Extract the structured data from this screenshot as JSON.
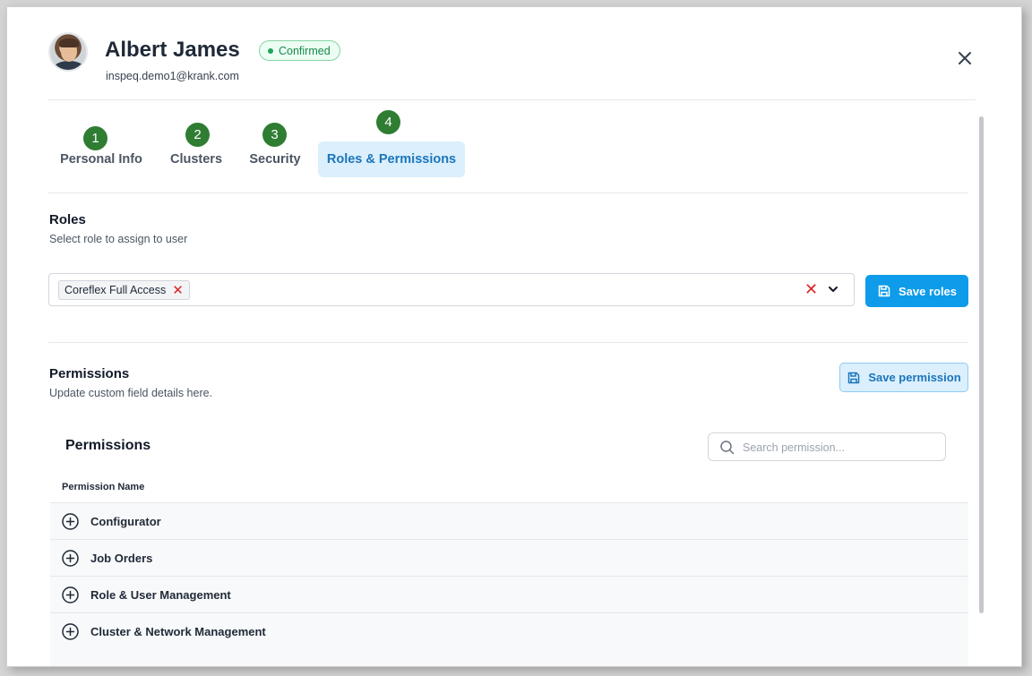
{
  "user": {
    "name": "Albert James",
    "status": "Confirmed",
    "email": "inspeq.demo1@krank.com"
  },
  "tabs": [
    {
      "step": "1",
      "label": "Personal Info",
      "active": false
    },
    {
      "step": "2",
      "label": "Clusters",
      "active": false
    },
    {
      "step": "3",
      "label": "Security",
      "active": false
    },
    {
      "step": "4",
      "label": "Roles & Permissions",
      "active": true
    }
  ],
  "roles": {
    "title": "Roles",
    "subtitle": "Select role to assign to user",
    "selected": [
      "Coreflex Full Access"
    ],
    "save_label": "Save roles"
  },
  "permissions": {
    "title": "Permissions",
    "subtitle": "Update custom field details here.",
    "save_label": "Save permission",
    "table_title": "Permissions",
    "search_placeholder": "Search permission...",
    "column_header": "Permission Name",
    "rows": [
      "Configurator",
      "Job Orders",
      "Role & User Management",
      "Cluster & Network Management"
    ]
  },
  "icons": {
    "close": "close-icon",
    "chip_remove": "remove-icon",
    "clear": "clear-icon",
    "dropdown": "chevron-down-icon",
    "save": "floppy-disk-icon",
    "search": "search-icon",
    "expand": "plus-circle-icon"
  },
  "colors": {
    "primary": "#0e9be9",
    "active_tab_bg": "#dbeffc",
    "active_tab_text": "#1b75bb",
    "step_badge": "#2e7d32",
    "status_green": "#168a4a",
    "danger": "#dc2626"
  }
}
